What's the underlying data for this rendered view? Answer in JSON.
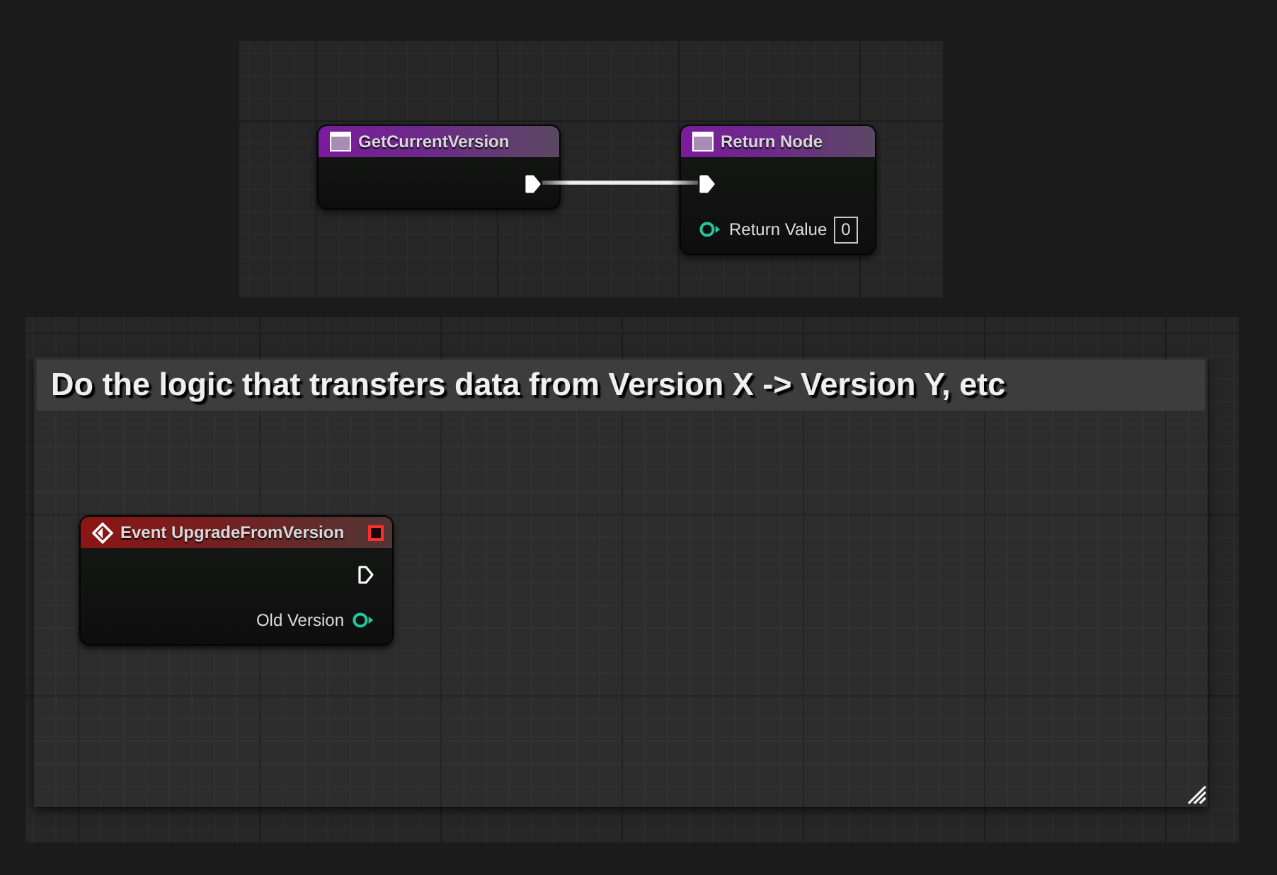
{
  "graphs": [
    {
      "nodes": [
        {
          "kind": "function",
          "title": "GetCurrentVersion",
          "delegate": false,
          "outputs": [
            {
              "kind": "exec",
              "connected": true
            }
          ]
        },
        {
          "kind": "function",
          "title": "Return Node",
          "delegate": false,
          "inputs": [
            {
              "kind": "exec",
              "connected": true
            },
            {
              "kind": "data",
              "label": "Return Value",
              "value": "0",
              "connected": false
            }
          ]
        }
      ]
    },
    {
      "comment": {
        "text": "Do the logic that transfers data from Version X -> Version Y, etc"
      },
      "nodes": [
        {
          "kind": "event",
          "title": "Event UpgradeFromVersion",
          "delegate": true,
          "outputs": [
            {
              "kind": "exec",
              "connected": false
            },
            {
              "kind": "data",
              "label": "Old Version",
              "connected": false
            }
          ]
        }
      ]
    }
  ]
}
